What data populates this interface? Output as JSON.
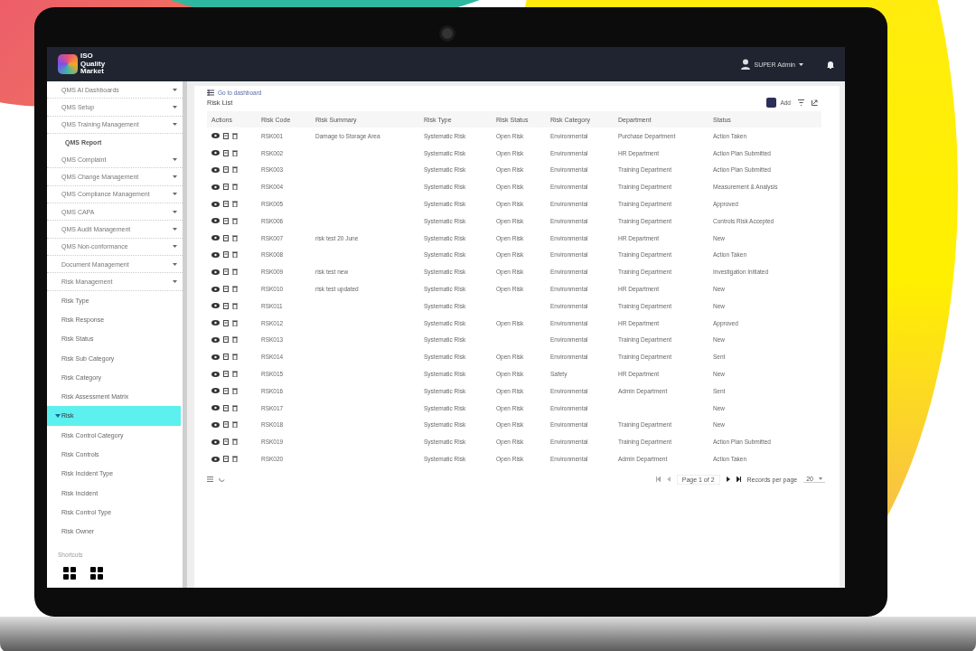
{
  "header": {
    "logo_lines": [
      "ISO",
      "Quality",
      "Market"
    ],
    "user": "SUPER Admin"
  },
  "sidebar": {
    "modules": [
      {
        "label": "QMS AI Dashboards",
        "kind": "group"
      },
      {
        "label": "QMS Setup",
        "kind": "group"
      },
      {
        "label": "QMS Training Management",
        "kind": "group"
      },
      {
        "label": "QMS Report",
        "kind": "sub"
      },
      {
        "label": "QMS Complaint",
        "kind": "group"
      },
      {
        "label": "QMS Change Management",
        "kind": "group"
      },
      {
        "label": "QMS Compliance Management",
        "kind": "group"
      },
      {
        "label": "QMS CAPA",
        "kind": "group"
      },
      {
        "label": "QMS Audit Management",
        "kind": "group"
      },
      {
        "label": "QMS Non-conformance",
        "kind": "group"
      },
      {
        "label": "Document Management",
        "kind": "group"
      },
      {
        "label": "Risk Management",
        "kind": "group"
      }
    ],
    "items": [
      {
        "label": "Risk Type",
        "selected": false
      },
      {
        "label": "Risk Response",
        "selected": false
      },
      {
        "label": "Risk Status",
        "selected": false
      },
      {
        "label": "Risk Sub Category",
        "selected": false
      },
      {
        "label": "Risk Category",
        "selected": false
      },
      {
        "label": "Risk Assessment Matrix",
        "selected": false
      },
      {
        "label": "Risk",
        "selected": true
      },
      {
        "label": "Risk Control Category",
        "selected": false
      },
      {
        "label": "Risk Controls",
        "selected": false
      },
      {
        "label": "Risk Incident Type",
        "selected": false
      },
      {
        "label": "Risk Incident",
        "selected": false
      },
      {
        "label": "Risk Control Type",
        "selected": false
      },
      {
        "label": "Risk Owner",
        "selected": false
      }
    ],
    "section_label": "Shortcuts"
  },
  "breadcrumb": "Go to dashboard",
  "title": "Risk List",
  "add_button": "Add",
  "table": {
    "columns": [
      "Actions",
      "Risk Code",
      "Risk Summary",
      "Risk Type",
      "Risk Status",
      "Risk Category",
      "Department",
      "Status"
    ],
    "rows": [
      {
        "code": "RSK001",
        "summary": "Damage to Storage Area",
        "type": "Systematic Risk",
        "status": "Open Risk",
        "category": "Environmental",
        "department": "Purchase Department",
        "state": "Action Taken"
      },
      {
        "code": "RSK002",
        "type": "Systematic Risk",
        "status": "Open Risk",
        "category": "Environmental",
        "department": "HR Department",
        "state": "Action Plan Submitted"
      },
      {
        "code": "RSK003",
        "type": "Systematic Risk",
        "status": "Open Risk",
        "category": "Environmental",
        "department": "Training Department",
        "state": "Action Plan Submitted"
      },
      {
        "code": "RSK004",
        "type": "Systematic Risk",
        "status": "Open Risk",
        "category": "Environmental",
        "department": "Training Department",
        "state": "Measurement & Analysis"
      },
      {
        "code": "RSK005",
        "type": "Systematic Risk",
        "status": "Open Risk",
        "category": "Environmental",
        "department": "Training Department",
        "state": "Approved"
      },
      {
        "code": "RSK006",
        "type": "Systematic Risk",
        "status": "Open Risk",
        "category": "Environmental",
        "department": "Training Department",
        "state": "Controls Risk Accepted"
      },
      {
        "code": "RSK007",
        "summary": "risk test 20 June",
        "type": "Systematic Risk",
        "status": "Open Risk",
        "category": "Environmental",
        "department": "HR Department",
        "state": "New"
      },
      {
        "code": "RSK008",
        "type": "Systematic Risk",
        "status": "Open Risk",
        "category": "Environmental",
        "department": "Training Department",
        "state": "Action Taken"
      },
      {
        "code": "RSK009",
        "summary": "risk test new",
        "type": "Systematic Risk",
        "status": "Open Risk",
        "category": "Environmental",
        "department": "Training Department",
        "state": "Investigation Initiated"
      },
      {
        "code": "RSK010",
        "summary": "risk test updated",
        "type": "Systematic Risk",
        "status": "Open Risk",
        "category": "Environmental",
        "department": "HR Department",
        "state": "New"
      },
      {
        "code": "RSK011",
        "type": "Systematic Risk",
        "category": "Environmental",
        "department": "Training Department",
        "state": "New"
      },
      {
        "code": "RSK012",
        "type": "Systematic Risk",
        "status": "Open Risk",
        "category": "Environmental",
        "department": "HR Department",
        "state": "Approved"
      },
      {
        "code": "RSK013",
        "type": "Systematic Risk",
        "category": "Environmental",
        "department": "Training Department",
        "state": "New"
      },
      {
        "code": "RSK014",
        "type": "Systematic Risk",
        "status": "Open Risk",
        "category": "Environmental",
        "department": "Training Department",
        "state": "Sent"
      },
      {
        "code": "RSK015",
        "type": "Systematic Risk",
        "status": "Open Risk",
        "category": "Safety",
        "department": "HR Department",
        "state": "New"
      },
      {
        "code": "RSK016",
        "type": "Systematic Risk",
        "status": "Open Risk",
        "category": "Environmental",
        "department": "Admin Department",
        "state": "Sent"
      },
      {
        "code": "RSK017",
        "type": "Systematic Risk",
        "status": "Open Risk",
        "category": "Environmental",
        "state": "New"
      },
      {
        "code": "RSK018",
        "type": "Systematic Risk",
        "status": "Open Risk",
        "category": "Environmental",
        "department": "Training Department",
        "state": "New"
      },
      {
        "code": "RSK019",
        "type": "Systematic Risk",
        "status": "Open Risk",
        "category": "Environmental",
        "department": "Training Department",
        "state": "Action Plan Submitted"
      },
      {
        "code": "RSK020",
        "type": "Systematic Risk",
        "status": "Open Risk",
        "category": "Environmental",
        "department": "Admin Department",
        "state": "Action Taken"
      }
    ]
  },
  "pagination": {
    "page_info": "Page 1 of 2",
    "per_page_label": "Records per page",
    "per_page": "20"
  }
}
